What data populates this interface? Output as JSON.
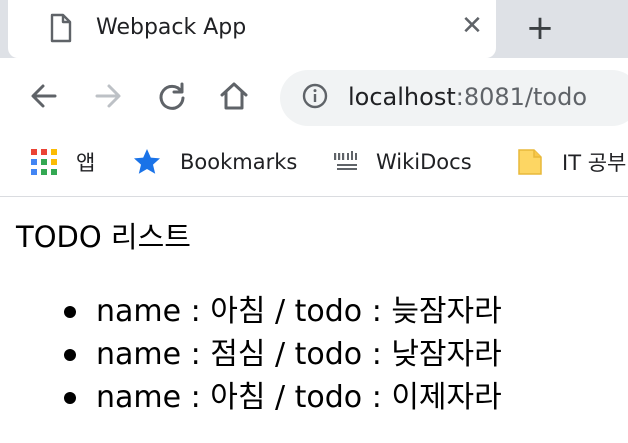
{
  "tab": {
    "title": "Webpack App",
    "close_label": "✕"
  },
  "newtab": {
    "label": "+"
  },
  "address_bar": {
    "url_host": "localhost",
    "url_rest": ":8081/todo"
  },
  "bookmarks": [
    {
      "label": "앱",
      "icon": "apps-grid-icon"
    },
    {
      "label": "Bookmarks",
      "icon": "star-icon"
    },
    {
      "label": "WikiDocs",
      "icon": "wikidocs-icon"
    },
    {
      "label": "IT 공부",
      "icon": "folder-icon"
    }
  ],
  "page": {
    "title": "TODO 리스트",
    "todos": [
      {
        "text": "name : 아침 / todo : 늦잠자라"
      },
      {
        "text": "name : 점심 / todo : 낮잠자라"
      },
      {
        "text": "name : 아침 / todo : 이제자라"
      }
    ]
  },
  "colors": {
    "tab_strip": "#dee1e6",
    "omnibox": "#f1f3f4",
    "star": "#1a73e8",
    "folder": "#fdd663"
  }
}
